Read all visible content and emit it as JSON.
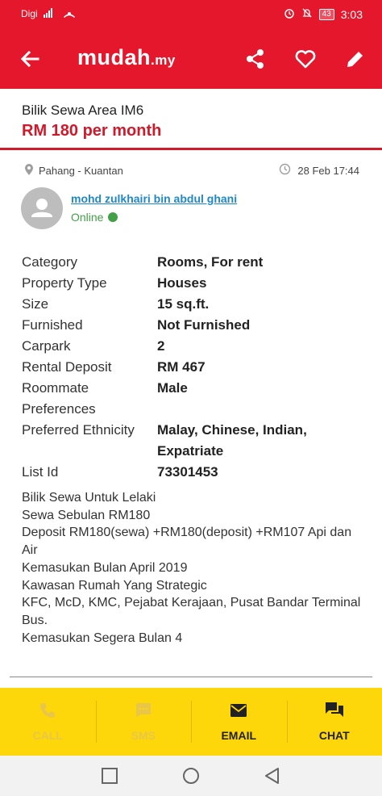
{
  "status_bar": {
    "carrier": "Digi",
    "network": "4G",
    "battery": "43",
    "time": "3:03"
  },
  "app_bar": {
    "logo_main": "mudah",
    "logo_tld": ".my",
    "icons": [
      "back-arrow-icon",
      "share-icon",
      "heart-icon",
      "edit-pencil-icon"
    ]
  },
  "listing": {
    "title": "Bilik Sewa Area IM6",
    "price": "RM 180 per month",
    "location": "Pahang - Kuantan",
    "date": "28 Feb 17:44"
  },
  "seller": {
    "name": "mohd zulkhairi bin abdul ghani",
    "status": "Online"
  },
  "details": [
    {
      "label": "Category",
      "value": "Rooms, For rent"
    },
    {
      "label": "Property Type",
      "value": "Houses"
    },
    {
      "label": "Size",
      "value": "15 sq.ft."
    },
    {
      "label": "Furnished",
      "value": "Not Furnished"
    },
    {
      "label": "Carpark",
      "value": "2"
    },
    {
      "label": "Rental Deposit",
      "value": "RM 467"
    },
    {
      "label": "Roommate Preferences",
      "value": "Male"
    },
    {
      "label": "Preferred Ethnicity",
      "value": "Malay, Chinese, Indian, Expatriate"
    },
    {
      "label": "List Id",
      "value": "73301453"
    }
  ],
  "description": [
    "Bilik Sewa Untuk Lelaki",
    "Sewa Sebulan RM180",
    "Deposit RM180(sewa) +RM180(deposit) +RM107 Api dan Air",
    "Kemasukan Bulan April 2019",
    "Kawasan Rumah Yang Strategic",
    "KFC, McD, KMC, Pejabat Kerajaan, Pusat Bandar Terminal Bus.",
    "Kemasukan Segera Bulan 4"
  ],
  "actions": {
    "call": "CALL",
    "sms": "SMS",
    "email": "EMAIL",
    "chat": "CHAT"
  },
  "colors": {
    "brand_red": "#e4172c",
    "price_red": "#d0192b",
    "action_yellow": "#fed70a",
    "link_blue": "#1e88c8",
    "online_green": "#43a047"
  }
}
